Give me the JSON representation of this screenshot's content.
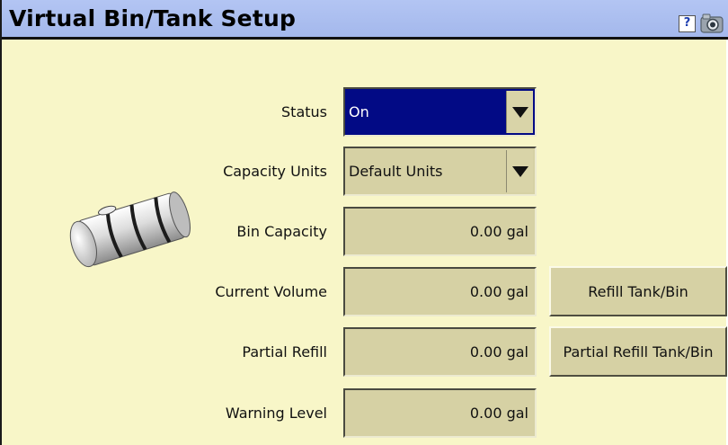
{
  "window": {
    "title": "Virtual Bin/Tank Setup"
  },
  "toolbar": {
    "help_label": "?",
    "help_icon": "help-icon",
    "screenshot_icon": "camera-icon"
  },
  "form": {
    "status": {
      "label": "Status",
      "value": "On"
    },
    "capacity_units": {
      "label": "Capacity Units",
      "value": "Default Units"
    },
    "bin_capacity": {
      "label": "Bin Capacity",
      "value": "0.00 gal"
    },
    "current_volume": {
      "label": "Current Volume",
      "value": "0.00 gal"
    },
    "partial_refill": {
      "label": "Partial Refill",
      "value": "0.00 gal"
    },
    "warning_level": {
      "label": "Warning Level",
      "value": "0.00 gal"
    }
  },
  "buttons": {
    "refill": "Refill Tank/Bin",
    "partial_refill": "Partial Refill Tank/Bin"
  },
  "colors": {
    "panel_bg": "#f8f6c8",
    "title_bar": "#b3c5f3",
    "field_bg": "#d6d1a4",
    "selected_bg": "#020a85"
  }
}
